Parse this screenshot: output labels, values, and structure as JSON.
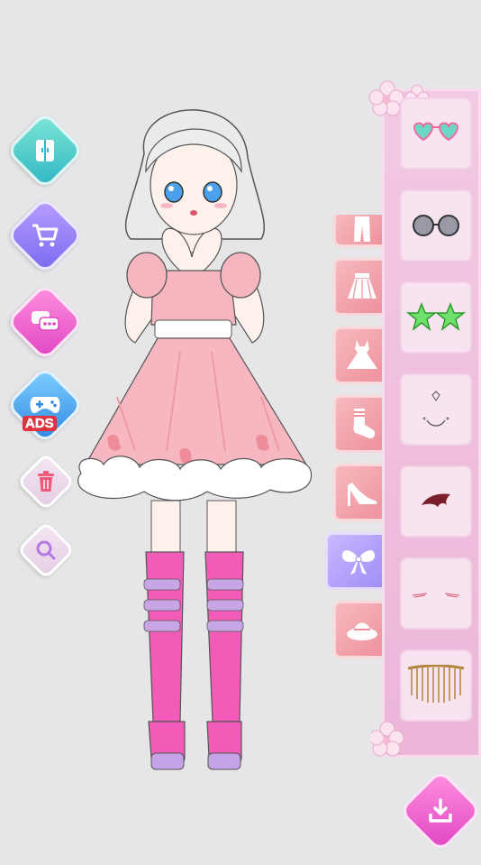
{
  "toolbar": {
    "ads_label": "ADS",
    "buttons": [
      "wardrobe",
      "shop",
      "chat",
      "ads-game",
      "delete",
      "zoom"
    ]
  },
  "categories": [
    "pants",
    "skirt",
    "dress",
    "socks",
    "shoes",
    "accessories",
    "hat"
  ],
  "active_category": "accessories",
  "items": [
    "heart-glasses",
    "round-glasses",
    "star-glasses",
    "face-decoration",
    "bat-wing-mark",
    "blush-lines",
    "gold-fringe"
  ],
  "colors": {
    "background": "#e6e6e8",
    "panel": "#ecb6d8",
    "category_tab": "#ee8f9a",
    "active_tab": "#9f8cf6",
    "accent_pink": "#e046c4"
  }
}
